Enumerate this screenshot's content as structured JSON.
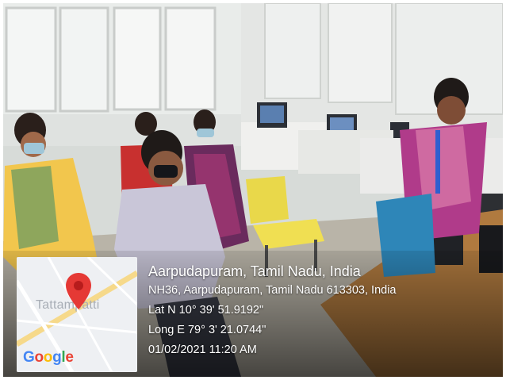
{
  "location": {
    "title": "Aarpudapuram, Tamil Nadu, India",
    "address": "NH36, Aarpudapuram, Tamil Nadu 613303, India",
    "latitude": "Lat N 10° 39' 51.9192\"",
    "longitude": "Long E 79° 3' 21.0744\"",
    "timestamp": "01/02/2021 11:20 AM"
  },
  "map": {
    "place_label": "Tattampatti",
    "pin_color": "#e53935",
    "pin_icon": "map-pin-icon",
    "brand": {
      "letters": [
        "G",
        "o",
        "o",
        "g",
        "l",
        "e"
      ],
      "colors": [
        "#4285F4",
        "#EA4335",
        "#FBBC05",
        "#4285F4",
        "#34A853",
        "#EA4335"
      ]
    }
  },
  "scene": {
    "description_icons": [
      "office-window",
      "computer-monitor",
      "yellow-chair",
      "desk"
    ]
  }
}
